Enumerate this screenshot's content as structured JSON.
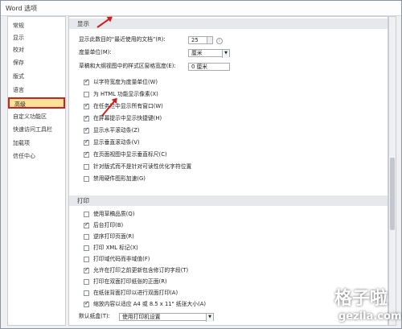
{
  "window": {
    "title": "Word 选项"
  },
  "sidebar": {
    "items": [
      {
        "label": "常规"
      },
      {
        "label": "显示"
      },
      {
        "label": "校对"
      },
      {
        "label": "保存"
      },
      {
        "label": "版式"
      },
      {
        "label": "语言"
      },
      {
        "label": "高级"
      },
      {
        "label": "自定义功能区"
      },
      {
        "label": "快速访问工具栏"
      },
      {
        "label": "加载项"
      },
      {
        "label": "信任中心"
      }
    ]
  },
  "display_section": {
    "title": "显示",
    "recent_docs_label": "显示此数目的“最近使用的文档”(R):",
    "recent_docs_value": "25",
    "unit_label": "度量单位(M):",
    "unit_value": "厘米",
    "style_width_label": "草稿和大纲视图中的样式区窗格宽度(E):",
    "style_width_value": "0 厘米",
    "checkboxes": [
      {
        "label": "以字符宽度为度量单位(W)",
        "checked": true
      },
      {
        "label": "为 HTML 功能显示像素(X)",
        "checked": false
      },
      {
        "label": "在任务栏中显示所有窗口(W)",
        "checked": true
      },
      {
        "label": "在屏幕提示中显示快捷键(H)",
        "checked": true
      },
      {
        "label": "显示水平滚动条(Z)",
        "checked": true
      },
      {
        "label": "显示垂直滚动条(V)",
        "checked": true
      },
      {
        "label": "在页面视图中显示垂直标尺(C)",
        "checked": true
      },
      {
        "label": "针对版式而不是针对可读性优化字符位置",
        "checked": false
      },
      {
        "label": "禁用硬件图形加速(G)",
        "checked": false
      }
    ]
  },
  "print_section": {
    "title": "打印",
    "checkboxes": [
      {
        "label": "使用草稿品质(Q)",
        "checked": false
      },
      {
        "label": "后台打印(B)",
        "checked": true
      },
      {
        "label": "逆序打印页面(R)",
        "checked": false
      },
      {
        "label": "打印 XML 标记(X)",
        "checked": false
      },
      {
        "label": "打印域代码而非域值(F)",
        "checked": false
      },
      {
        "label": "允许在打印之前更新包含修订的字段(T)",
        "checked": true
      },
      {
        "label": "打印在双面打印纸张的正面(R)",
        "checked": false
      },
      {
        "label": "在纸张背面打印以进行双面打印(A)",
        "checked": false
      },
      {
        "label": "缩放内容以适应 A4 或 8.5 x 11\" 纸张大小(A)",
        "checked": true
      }
    ],
    "paper_tray_label": "默认纸盒(T):",
    "paper_tray_value": "使用打印机设置"
  },
  "watermark": {
    "line1": "格子啦",
    "line2": "gezila.com"
  },
  "colors": {
    "selected_bg": "#fde29a",
    "highlight_border": "#d02020",
    "arrow": "#d01c1c"
  }
}
